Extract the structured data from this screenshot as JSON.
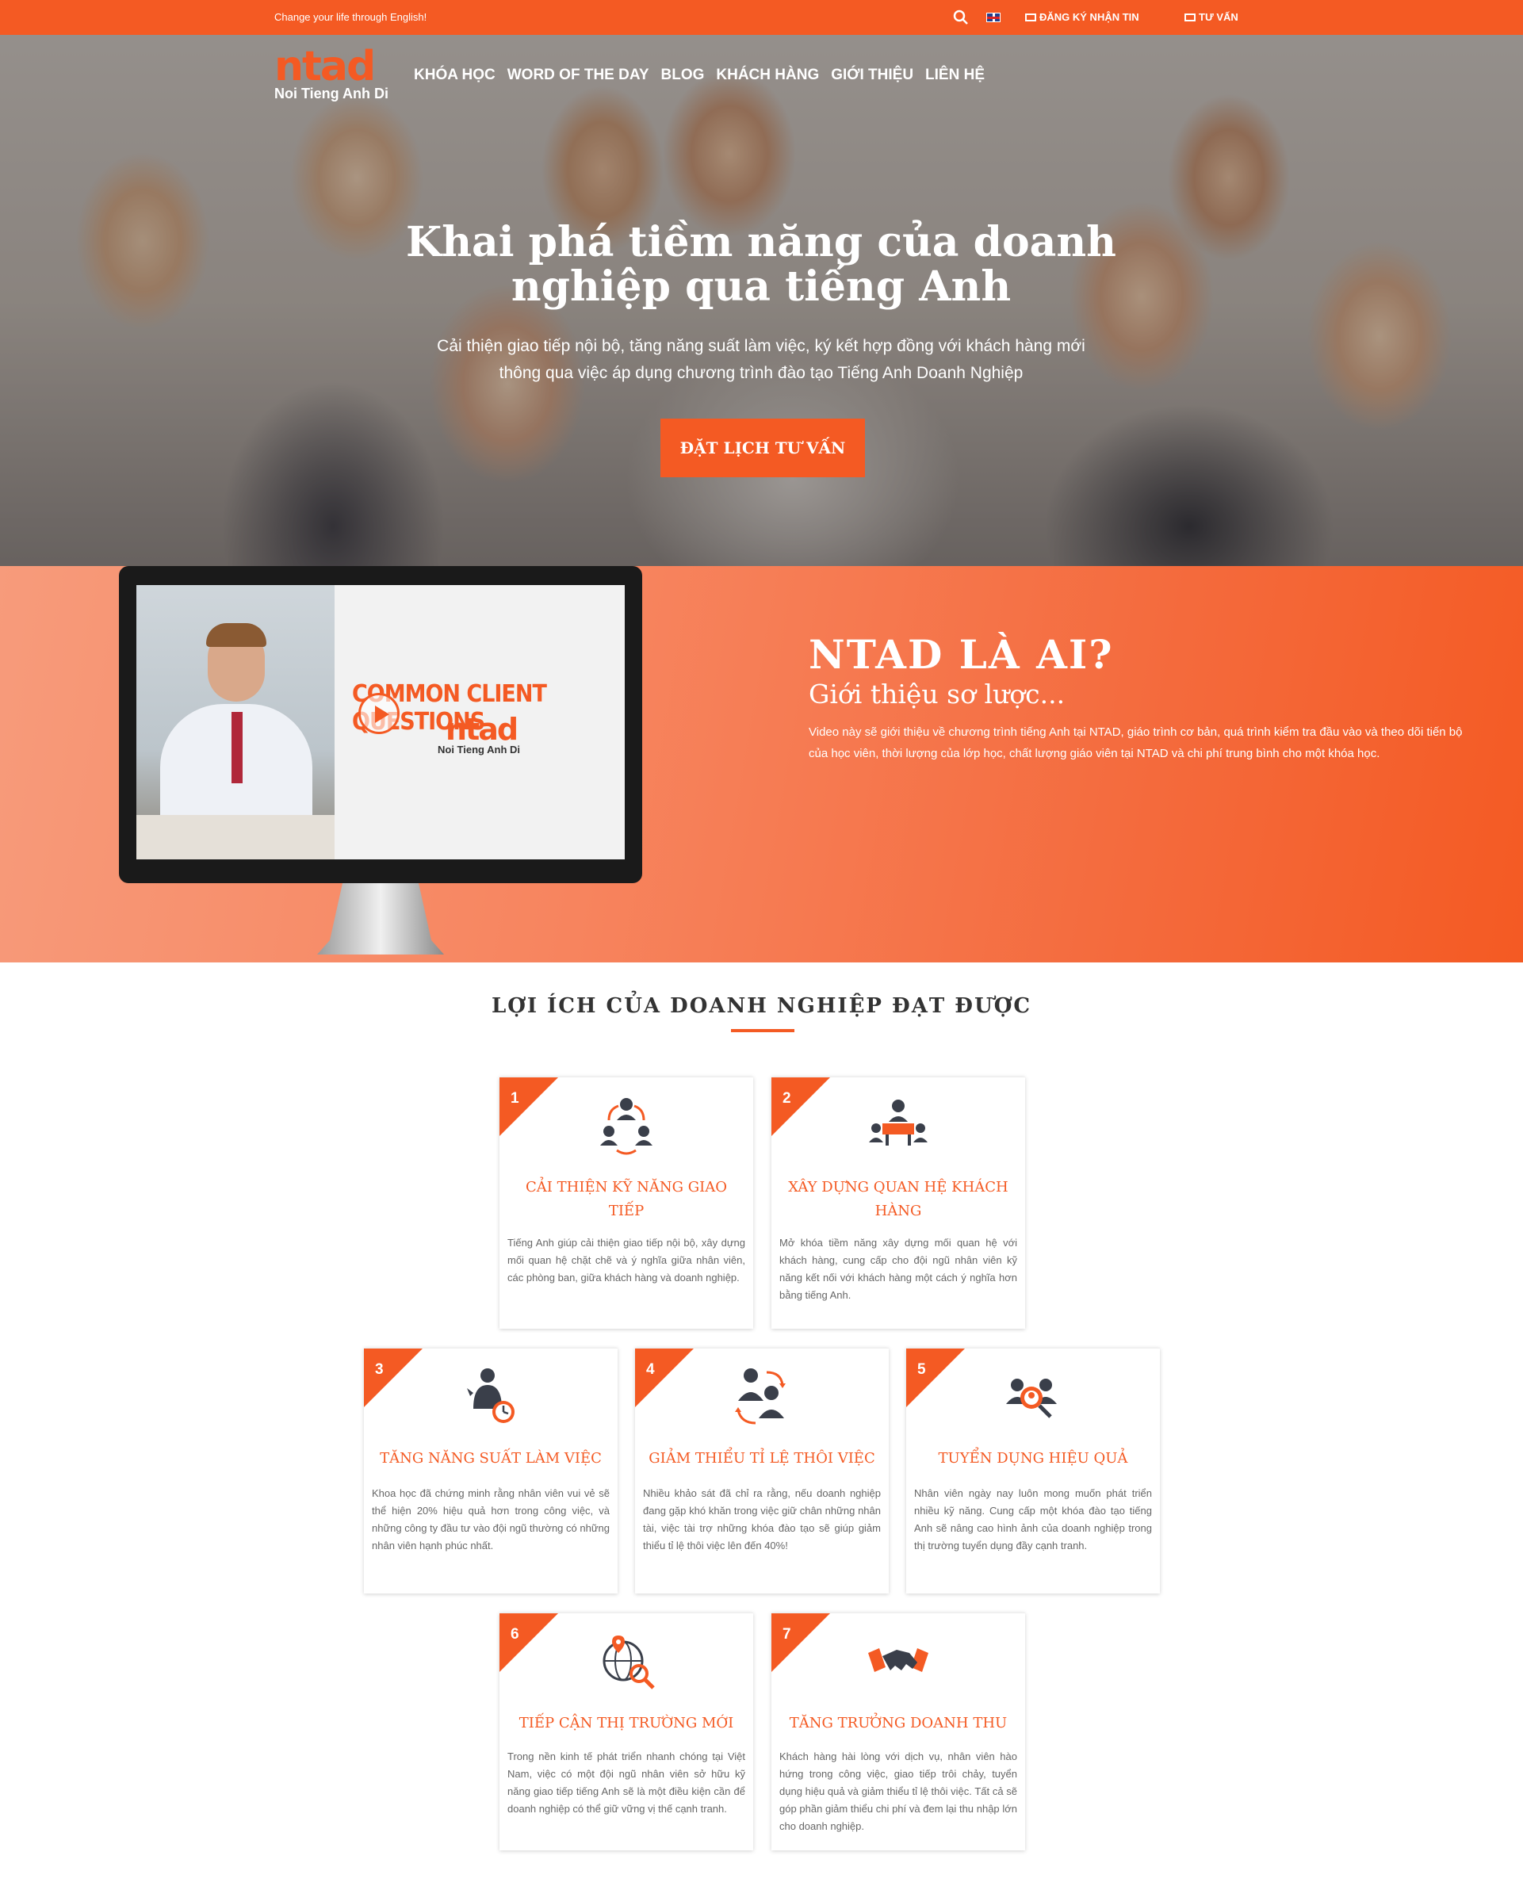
{
  "topbar": {
    "tagline": "Change your life through English!",
    "subscribe": "ĐĂNG KÝ NHẬN TIN",
    "consult": "TƯ VẤN"
  },
  "logo": {
    "mark": "ntad",
    "sub": "Noi Tieng Anh Di"
  },
  "nav": [
    "KHÓA HỌC",
    "WORD OF THE DAY",
    "BLOG",
    "KHÁCH HÀNG",
    "GIỚI THIỆU",
    "LIÊN HỆ"
  ],
  "hero": {
    "title_line1": "Khai phá tiềm năng của doanh",
    "title_line2": "nghiệp qua tiếng Anh",
    "text_line1": "Cải thiện giao tiếp nội bộ, tăng năng suất làm việc, ký kết hợp đồng với khách hàng mới",
    "text_line2": "thông qua việc áp dụng chương trình đào tạo Tiếng Anh Doanh Nghiệp",
    "cta": "ĐẶT LỊCH TƯ VẤN"
  },
  "video": {
    "headline": "COMMON CLIENT QUESTIONS",
    "logo": "ntad",
    "logo_sub": "Noi Tieng Anh Di"
  },
  "about": {
    "title": "NTAD LÀ AI?",
    "subtitle": "Giới thiệu sơ lược...",
    "description": "Video này sẽ giới thiệu về chương trình tiếng Anh tại NTAD, giáo trình cơ bản, quá trình kiểm tra đầu vào và theo dõi tiến bộ của học viên, thời lượng của lớp học, chất lượng giáo viên tại NTAD và chi phí trung bình cho một khóa học."
  },
  "benefits": {
    "title": "LỢI ÍCH CỦA DOANH NGHIỆP ĐẠT ĐƯỢC",
    "cards": [
      {
        "num": "1",
        "icon": "communication-icon",
        "title": "CẢI THIỆN KỸ NĂNG GIAO TIẾP",
        "text": "Tiếng Anh giúp cải thiện giao tiếp nội bộ, xây dựng mối quan hệ chặt chẽ và ý nghĩa giữa nhân viên, các phòng ban, giữa khách hàng và doanh nghiệp."
      },
      {
        "num": "2",
        "icon": "meeting-icon",
        "title": "XÂY DỰNG QUAN HỆ KHÁCH HÀNG",
        "text": "Mở khóa tiềm năng xây dựng mối quan hệ với khách hàng, cung cấp cho đội ngũ nhân viên kỹ năng kết nối với khách hàng một cách ý nghĩa hơn bằng tiếng Anh."
      },
      {
        "num": "3",
        "icon": "productivity-icon",
        "title": "TĂNG NĂNG SUẤT LÀM VIỆC",
        "text": "Khoa học đã chứng minh rằng nhân viên vui vẻ sẽ thể hiện 20% hiệu quả hơn trong công việc, và những công ty đầu tư vào đội ngũ thường có những nhân viên hạnh phúc nhất."
      },
      {
        "num": "4",
        "icon": "retention-icon",
        "title": "GIẢM THIỂU TỈ LỆ THÔI VIỆC",
        "text": "Nhiều khảo sát đã chỉ ra rằng, nếu doanh nghiệp đang gặp khó khăn trong việc giữ chân những nhân tài, việc tài trợ những khóa đào tạo sẽ giúp giảm thiểu tỉ lệ thôi việc lên đến 40%!"
      },
      {
        "num": "5",
        "icon": "recruitment-icon",
        "title": "TUYỂN DỤNG HIỆU QUẢ",
        "text": "Nhân viên ngày nay luôn mong muốn phát triển nhiều kỹ năng. Cung cấp một khóa đào tạo tiếng Anh sẽ nâng cao hình ảnh của doanh nghiệp trong thị trường tuyển dụng đầy cạnh tranh."
      },
      {
        "num": "6",
        "icon": "global-market-icon",
        "title": "TIẾP CẬN THỊ TRƯỜNG MỚI",
        "text": "Trong nền kinh tế phát triển nhanh chóng tại Việt Nam, việc có một đội ngũ nhân viên sở hữu kỹ năng giao tiếp tiếng Anh sẽ là một điều kiện cần để doanh nghiệp có thể giữ vững vị thế cạnh tranh."
      },
      {
        "num": "7",
        "icon": "handshake-icon",
        "title": "TĂNG TRƯỞNG DOANH THU",
        "text": "Khách hàng hài lòng với dịch vụ, nhân viên hào hứng trong công việc, giao tiếp trôi chảy, tuyển dụng hiệu quả và giảm thiểu tỉ lệ thôi việc. Tất cả sẽ góp phần giảm thiểu chi phí và đem lại thu nhập lớn cho doanh nghiệp."
      }
    ]
  },
  "colors": {
    "accent": "#f45a23",
    "text_dark": "#333333",
    "icon_dark": "#3a3f4a"
  }
}
